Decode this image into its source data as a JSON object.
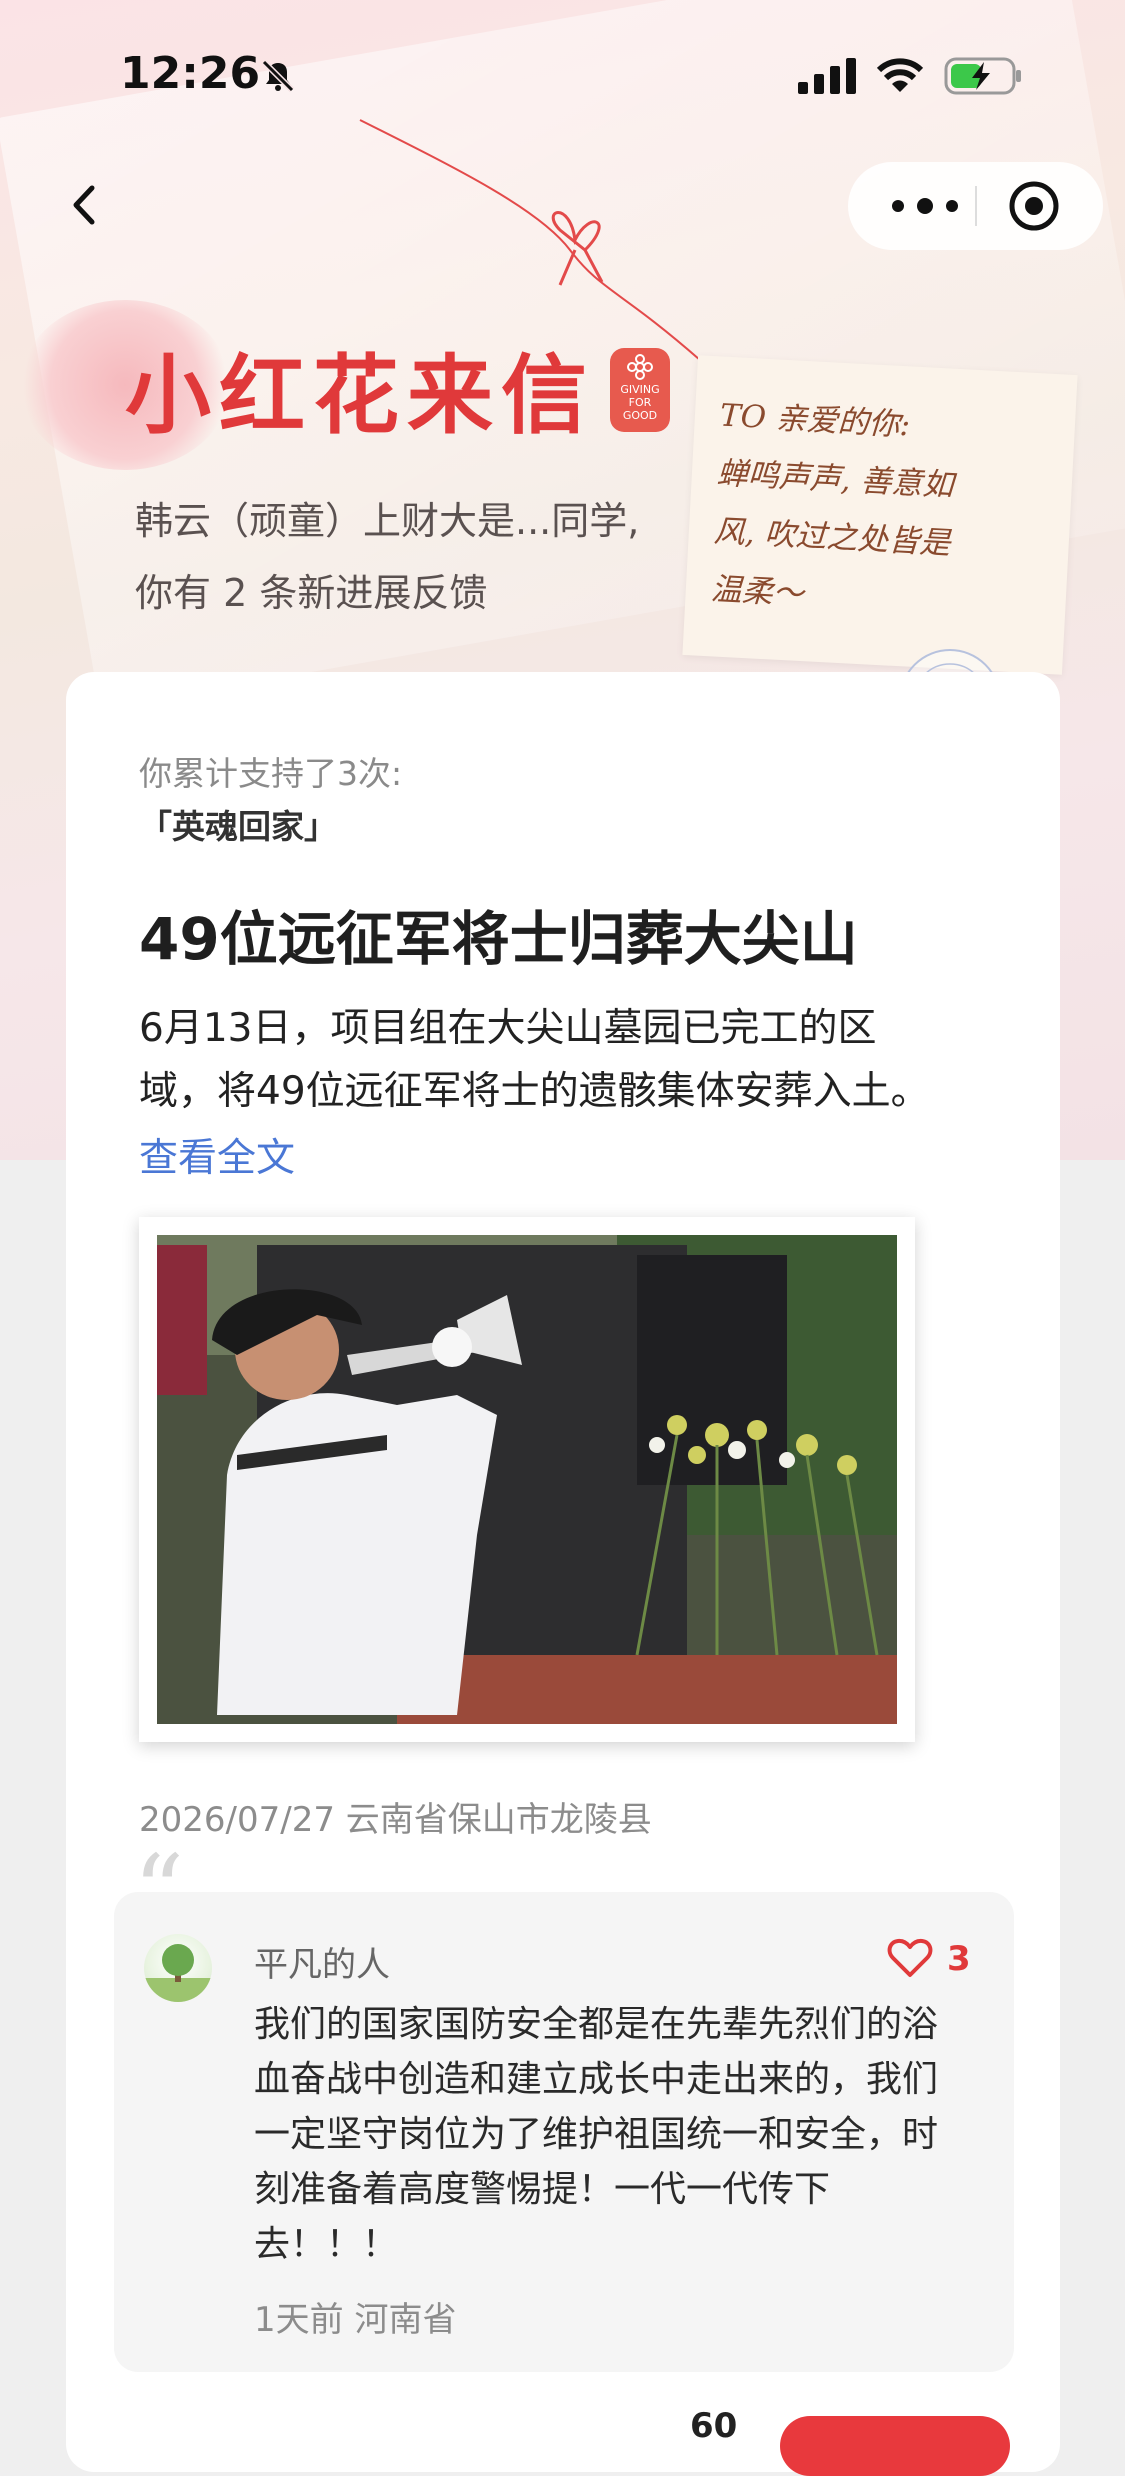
{
  "status_bar": {
    "time": "12:26"
  },
  "header": {
    "logo_text": "小红花来信",
    "logo_badge_line1": "GIVING",
    "logo_badge_line2": "FOR GOOD",
    "greeting_line1": "韩云（顽童）上财大是...同学,",
    "greeting_line2": "你有 2 条新进展反馈",
    "note_lines": [
      "TO 亲爱的你:",
      "蝉鸣声声, 善意如",
      "风, 吹过之处皆是",
      "温柔～"
    ]
  },
  "card": {
    "support_count": "你累计支持了3次:",
    "project_name": "「英魂回家」",
    "headline": "49位远征军将士归葬大尖山",
    "body_line1": "6月13日，项目组在大尖山墓园已完工的区",
    "body_line2": "域，将49位远征军将士的遗骸集体安葬入土。",
    "read_more": "查看全文",
    "meta": "2026/07/27 云南省保山市龙陵县"
  },
  "comment": {
    "author": "平凡的人",
    "likes": "3",
    "lines": [
      "我们的国家国防安全都是在先辈先烈们的浴",
      "血奋战中创造和建立成长中走出来的，我们",
      "一定坚守岗位为了维护祖国统一和安全，时",
      "刻准备着高度警惕提！一代一代传下",
      "去！！！"
    ],
    "meta": "1天前 河南省"
  },
  "footer": {
    "partial_number": "60"
  },
  "colors": {
    "brand_red": "#e0393a",
    "link_blue": "#4a77d5"
  }
}
